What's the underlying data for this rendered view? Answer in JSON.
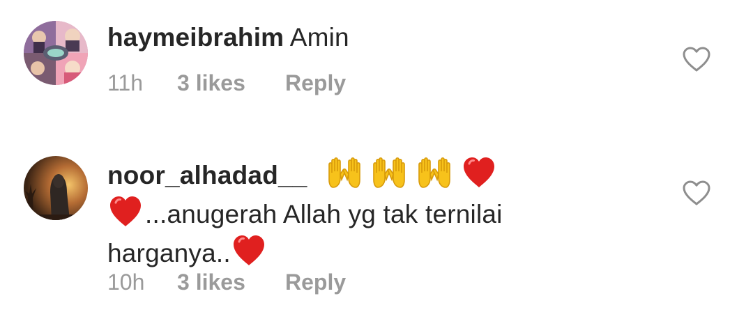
{
  "comments": [
    {
      "username": "haymeibrahim",
      "text_line1": "Amin",
      "time": "11h",
      "likes": "3 likes",
      "reply": "Reply",
      "emojis": []
    },
    {
      "username": "noor_alhadad__",
      "text_line2": "...anugerah Allah yg tak ternilai",
      "text_line3": "harganya..",
      "time": "10h",
      "likes": "3 likes",
      "reply": "Reply",
      "emojis": [
        "raised-hands",
        "raised-hands",
        "raised-hands",
        "red-heart",
        "red-heart",
        "red-heart"
      ]
    }
  ],
  "icons": {
    "like": "heart-outline-icon"
  },
  "colors": {
    "text": "#262626",
    "meta": "#9a9a9a",
    "heart_outline": "#8e8e8e",
    "emoji_heart": "#e0201f",
    "emoji_hands": "#f7c21b"
  }
}
